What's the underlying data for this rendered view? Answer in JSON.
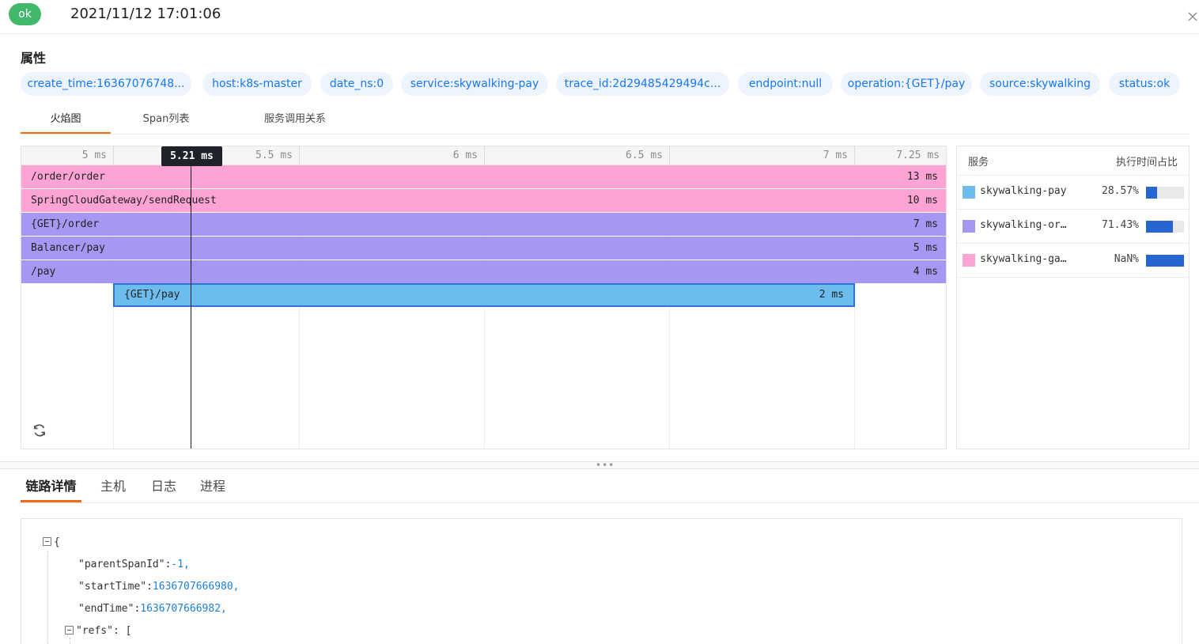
{
  "header": {
    "status": "ok",
    "datetime": "2021/11/12 17:01:06"
  },
  "attributes": {
    "title": "属性",
    "tags": [
      "create_time:16367076748...",
      "host:k8s-master",
      "date_ns:0",
      "service:skywalking-pay",
      "trace_id:2d29485429494c...",
      "endpoint:null",
      "operation:{GET}/pay",
      "source:skywalking",
      "status:ok"
    ]
  },
  "view_tabs": [
    "火焰图",
    "Span列表",
    "服务调用关系"
  ],
  "flame": {
    "ticks": [
      "5 ms",
      "5.5 ms",
      "6 ms",
      "6.5 ms",
      "7 ms",
      "7.25 ms"
    ],
    "cursor": "5.21 ms",
    "spans": [
      {
        "name": "/order/order",
        "duration": "13 ms",
        "service": "skywalking-gateway"
      },
      {
        "name": "SpringCloudGateway/sendRequest",
        "duration": "10 ms",
        "service": "skywalking-gateway"
      },
      {
        "name": "{GET}/order",
        "duration": "7 ms",
        "service": "skywalking-order"
      },
      {
        "name": "Balancer/pay",
        "duration": "5 ms",
        "service": "skywalking-order"
      },
      {
        "name": "/pay",
        "duration": "4 ms",
        "service": "skywalking-order"
      },
      {
        "name": "{GET}/pay",
        "duration": "2 ms",
        "service": "skywalking-pay"
      }
    ]
  },
  "legend": {
    "col_service": "服务",
    "col_ratio": "执行时间占比",
    "rows": [
      {
        "name": "skywalking-pay",
        "percent": "28.57%",
        "fill": 0.2857,
        "color": "#6cbdee"
      },
      {
        "name": "skywalking-or…",
        "percent": "71.43%",
        "fill": 0.7143,
        "color": "#a796f2"
      },
      {
        "name": "skywalking-ga…",
        "percent": "NaN%",
        "fill": 1.0,
        "color": "#fda4d4"
      }
    ]
  },
  "detail_tabs": [
    "链路详情",
    "主机",
    "日志",
    "进程"
  ],
  "json_view": {
    "open_brace": "{",
    "parent_key": "\"parentSpanId\"",
    "parent_val": "-1,",
    "start_key": "\"startTime\"",
    "start_val": "1636707666980,",
    "end_key": "\"endTime\"",
    "end_val": "1636707666982,",
    "refs_line": "\"refs\": ["
  }
}
